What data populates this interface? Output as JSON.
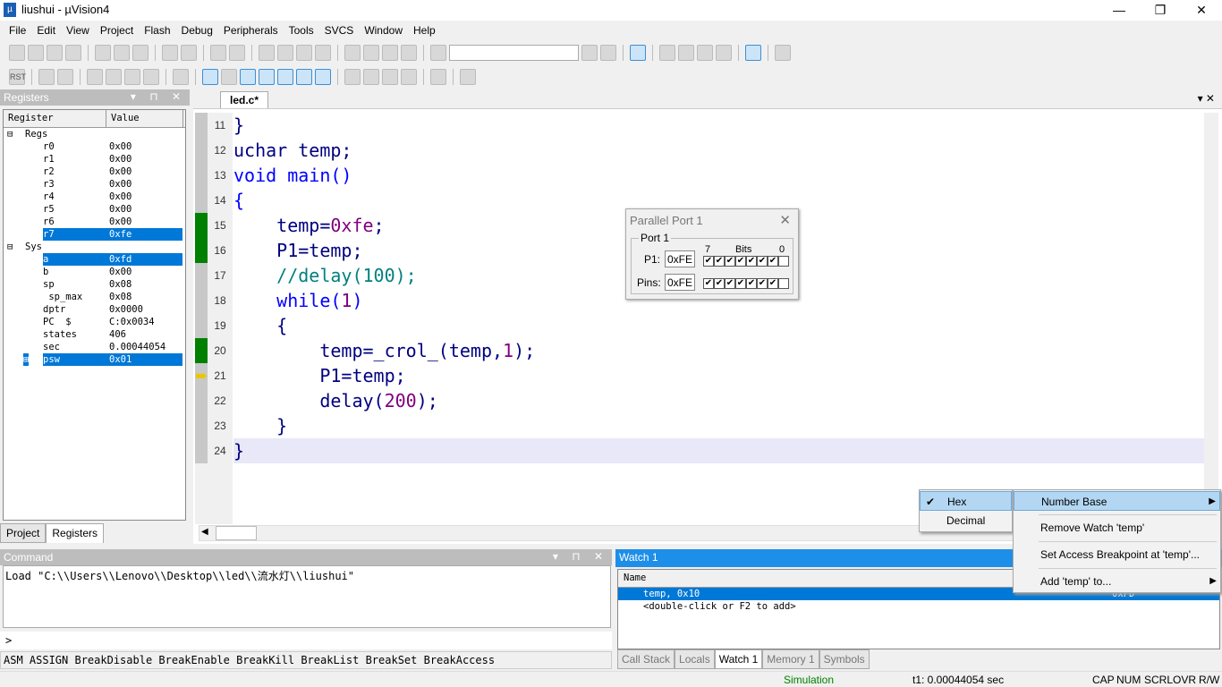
{
  "window": {
    "title": "liushui  - µVision4",
    "minimize": "—",
    "maximize": "❐",
    "close": "✕"
  },
  "menu": [
    "File",
    "Edit",
    "View",
    "Project",
    "Flash",
    "Debug",
    "Peripherals",
    "Tools",
    "SVCS",
    "Window",
    "Help"
  ],
  "toolbar2": {
    "rst": "RST"
  },
  "registers": {
    "title": "Registers",
    "col_register": "Register",
    "col_value": "Value",
    "groups": [
      {
        "name": "Regs",
        "items": [
          [
            "r0",
            "0x00"
          ],
          [
            "r1",
            "0x00"
          ],
          [
            "r2",
            "0x00"
          ],
          [
            "r3",
            "0x00"
          ],
          [
            "r4",
            "0x00"
          ],
          [
            "r5",
            "0x00"
          ],
          [
            "r6",
            "0x00"
          ],
          [
            "r7",
            "0xfe"
          ]
        ]
      },
      {
        "name": "Sys",
        "items": [
          [
            "a",
            "0xfd"
          ],
          [
            "b",
            "0x00"
          ],
          [
            "sp",
            "0x08"
          ],
          [
            " sp_max",
            "0x08"
          ],
          [
            "dptr",
            "0x0000"
          ],
          [
            "PC  $",
            "C:0x0034"
          ],
          [
            "states",
            "406"
          ],
          [
            "sec",
            "0.00044054"
          ],
          [
            "psw",
            "0x01"
          ]
        ]
      }
    ],
    "selected": [
      "r7",
      "a",
      "psw"
    ]
  },
  "left_tabs": [
    "Project",
    "Registers"
  ],
  "editor": {
    "tab": "led.c*",
    "lines": [
      {
        "n": "11",
        "t": [
          [
            "}",
            ""
          ]
        ]
      },
      {
        "n": "12",
        "t": [
          [
            "uchar temp;",
            ""
          ]
        ]
      },
      {
        "n": "13",
        "t": [
          [
            "void",
            "kw"
          ],
          [
            " main",
            "kw"
          ],
          [
            "()",
            "kw"
          ]
        ]
      },
      {
        "n": "14",
        "t": [
          [
            "{",
            "kw"
          ]
        ]
      },
      {
        "n": "15",
        "t": [
          [
            "    temp=",
            ""
          ],
          [
            "0xfe",
            "num"
          ],
          [
            ";",
            ""
          ]
        ]
      },
      {
        "n": "16",
        "t": [
          [
            "    P1=temp;",
            ""
          ]
        ]
      },
      {
        "n": "17",
        "t": [
          [
            "    //delay(100);",
            "cm"
          ]
        ]
      },
      {
        "n": "18",
        "t": [
          [
            "    while",
            "kw"
          ],
          [
            "(",
            "kw"
          ],
          [
            "1",
            "num"
          ],
          [
            ")",
            "kw"
          ]
        ]
      },
      {
        "n": "19",
        "t": [
          [
            "    {",
            ""
          ]
        ]
      },
      {
        "n": "20",
        "t": [
          [
            "        temp=_crol_(temp,",
            ""
          ],
          [
            "1",
            "num"
          ],
          [
            ");",
            ""
          ]
        ]
      },
      {
        "n": "21",
        "t": [
          [
            "        P1=temp;",
            ""
          ]
        ]
      },
      {
        "n": "22",
        "t": [
          [
            "        delay(",
            ""
          ],
          [
            "200",
            "num"
          ],
          [
            ");",
            ""
          ]
        ]
      },
      {
        "n": "23",
        "t": [
          [
            "    }",
            ""
          ]
        ]
      },
      {
        "n": "24",
        "t": [
          [
            "}",
            ""
          ]
        ]
      }
    ]
  },
  "parallel_port": {
    "title": "Parallel Port 1",
    "group": "Port 1",
    "bits_label": "Bits",
    "bit_hi": "7",
    "bit_lo": "0",
    "p1_label": "P1:",
    "p1_value": "0xFE",
    "pins_label": "Pins:",
    "pins_value": "0xFE",
    "p1_bits": [
      1,
      1,
      1,
      1,
      1,
      1,
      1,
      0
    ],
    "pins_bits": [
      1,
      1,
      1,
      1,
      1,
      1,
      1,
      0
    ]
  },
  "command": {
    "title": "Command",
    "output": "Load \"C:\\\\Users\\\\Lenovo\\\\Desktop\\\\led\\\\流水灯\\\\liushui\"",
    "prompt": ">",
    "help": "ASM ASSIGN BreakDisable BreakEnable BreakKill BreakList BreakSet BreakAccess"
  },
  "watch": {
    "title": "Watch 1",
    "col_name": "Name",
    "rows": [
      {
        "name": "temp, 0x10",
        "value": "0xFD"
      },
      {
        "name": "<double-click or F2 to add>",
        "value": ""
      }
    ]
  },
  "watch_tabs": [
    "Call Stack",
    "Locals",
    "Watch 1",
    "Memory 1",
    "Symbols"
  ],
  "context_menu": {
    "items": [
      "Number Base",
      "Remove Watch 'temp'",
      "Set Access Breakpoint at 'temp'...",
      "Add 'temp' to..."
    ],
    "submenu": [
      "Hex",
      "Decimal"
    ],
    "checked": "Hex"
  },
  "status": {
    "mode": "Simulation",
    "time": "t1: 0.00044054 sec",
    "flags": [
      "CAP",
      "NUM",
      "SCRL",
      "OVR",
      "R/W"
    ]
  },
  "colors": {
    "selection": "#0078d7",
    "breakpoint_marker": "#008000",
    "watch_header": "#1e8fe8",
    "status_mode": "#008000"
  }
}
